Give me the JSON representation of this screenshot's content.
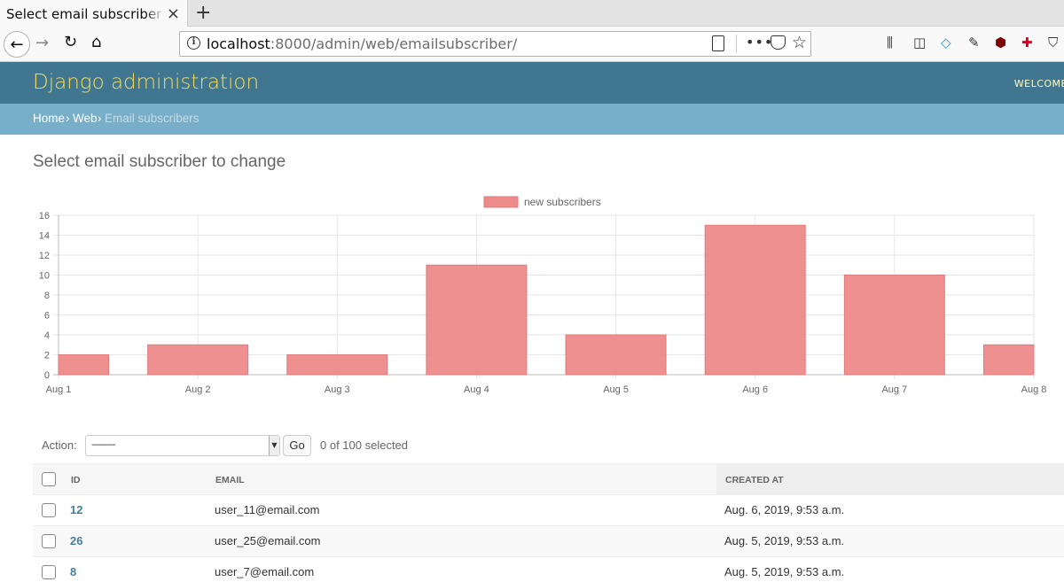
{
  "browser": {
    "tab_title": "Select email subscriber to change",
    "new_tab": "+",
    "url_host": "localhost",
    "url_rest": ":8000/admin/web/emailsubscriber/"
  },
  "header": {
    "brand": "Django administration",
    "welcome": "WELCOME"
  },
  "breadcrumbs": {
    "home": "Home",
    "app": "Web",
    "current": "Email subscribers",
    "separator": "›"
  },
  "page": {
    "title": "Select email subscriber to change"
  },
  "chart_data": {
    "type": "bar",
    "categories": [
      "Aug 1",
      "Aug 2",
      "Aug 3",
      "Aug 4",
      "Aug 5",
      "Aug 6",
      "Aug 7",
      "Aug 8"
    ],
    "series": [
      {
        "name": "new subscribers",
        "values": [
          2,
          3,
          2,
          11,
          4,
          15,
          10,
          3
        ],
        "color": "#ed8a8a"
      }
    ],
    "ylim": [
      0,
      16
    ],
    "yticks": [
      0,
      2,
      4,
      6,
      8,
      10,
      12,
      14,
      16
    ],
    "grid": true,
    "legend": "top-center"
  },
  "actions": {
    "label": "Action:",
    "select_value": "---------",
    "go_label": "Go",
    "selected_text": "0 of 100 selected"
  },
  "table": {
    "headers": {
      "id": "ID",
      "email": "EMAIL",
      "created_at": "CREATED AT"
    },
    "rows": [
      {
        "id": "12",
        "email": "user_11@email.com",
        "created_at": "Aug. 6, 2019, 9:53 a.m."
      },
      {
        "id": "26",
        "email": "user_25@email.com",
        "created_at": "Aug. 5, 2019, 9:53 a.m."
      },
      {
        "id": "8",
        "email": "user_7@email.com",
        "created_at": "Aug. 5, 2019, 9:53 a.m."
      }
    ]
  }
}
